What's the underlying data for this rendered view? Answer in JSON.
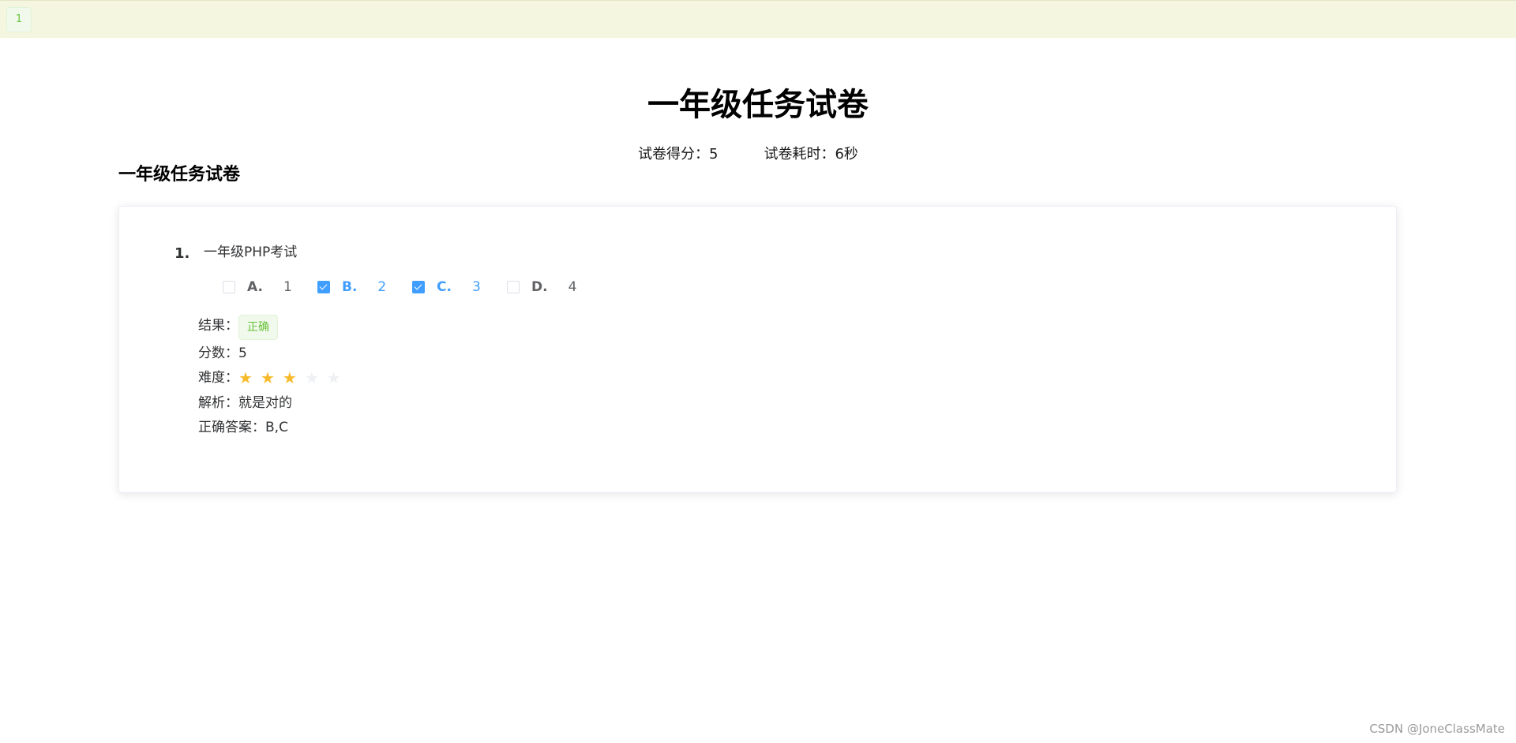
{
  "top_bar": {
    "tab_label": "1",
    "background": "#f5f6df"
  },
  "paper": {
    "title": "一年级任务试卷",
    "score_label": "试卷得分：",
    "score_value": "5",
    "time_label": "试卷耗时：",
    "time_value": "6秒",
    "section_title": "一年级任务试卷"
  },
  "question": {
    "number": "1.",
    "text": "一年级PHP考试",
    "options": [
      {
        "letter": "A.",
        "value": "1",
        "checked": false
      },
      {
        "letter": "B.",
        "value": "2",
        "checked": true
      },
      {
        "letter": "C.",
        "value": "3",
        "checked": true
      },
      {
        "letter": "D.",
        "value": "4",
        "checked": false
      }
    ],
    "result_label": "结果：",
    "result_value": "正确",
    "score_label": "分数：",
    "score_value": "5",
    "difficulty_label": "难度：",
    "difficulty_rating": 3,
    "difficulty_max": 5,
    "analysis_label": "解析：",
    "analysis_value": "就是对的",
    "answer_label": "正确答案：",
    "answer_value": "B,C"
  },
  "watermark": "CSDN @JoneClassMate",
  "colors": {
    "accent": "#409eff",
    "success": "#67c23a",
    "star_on": "#f7ba2a",
    "star_off": "#eef0f3"
  }
}
